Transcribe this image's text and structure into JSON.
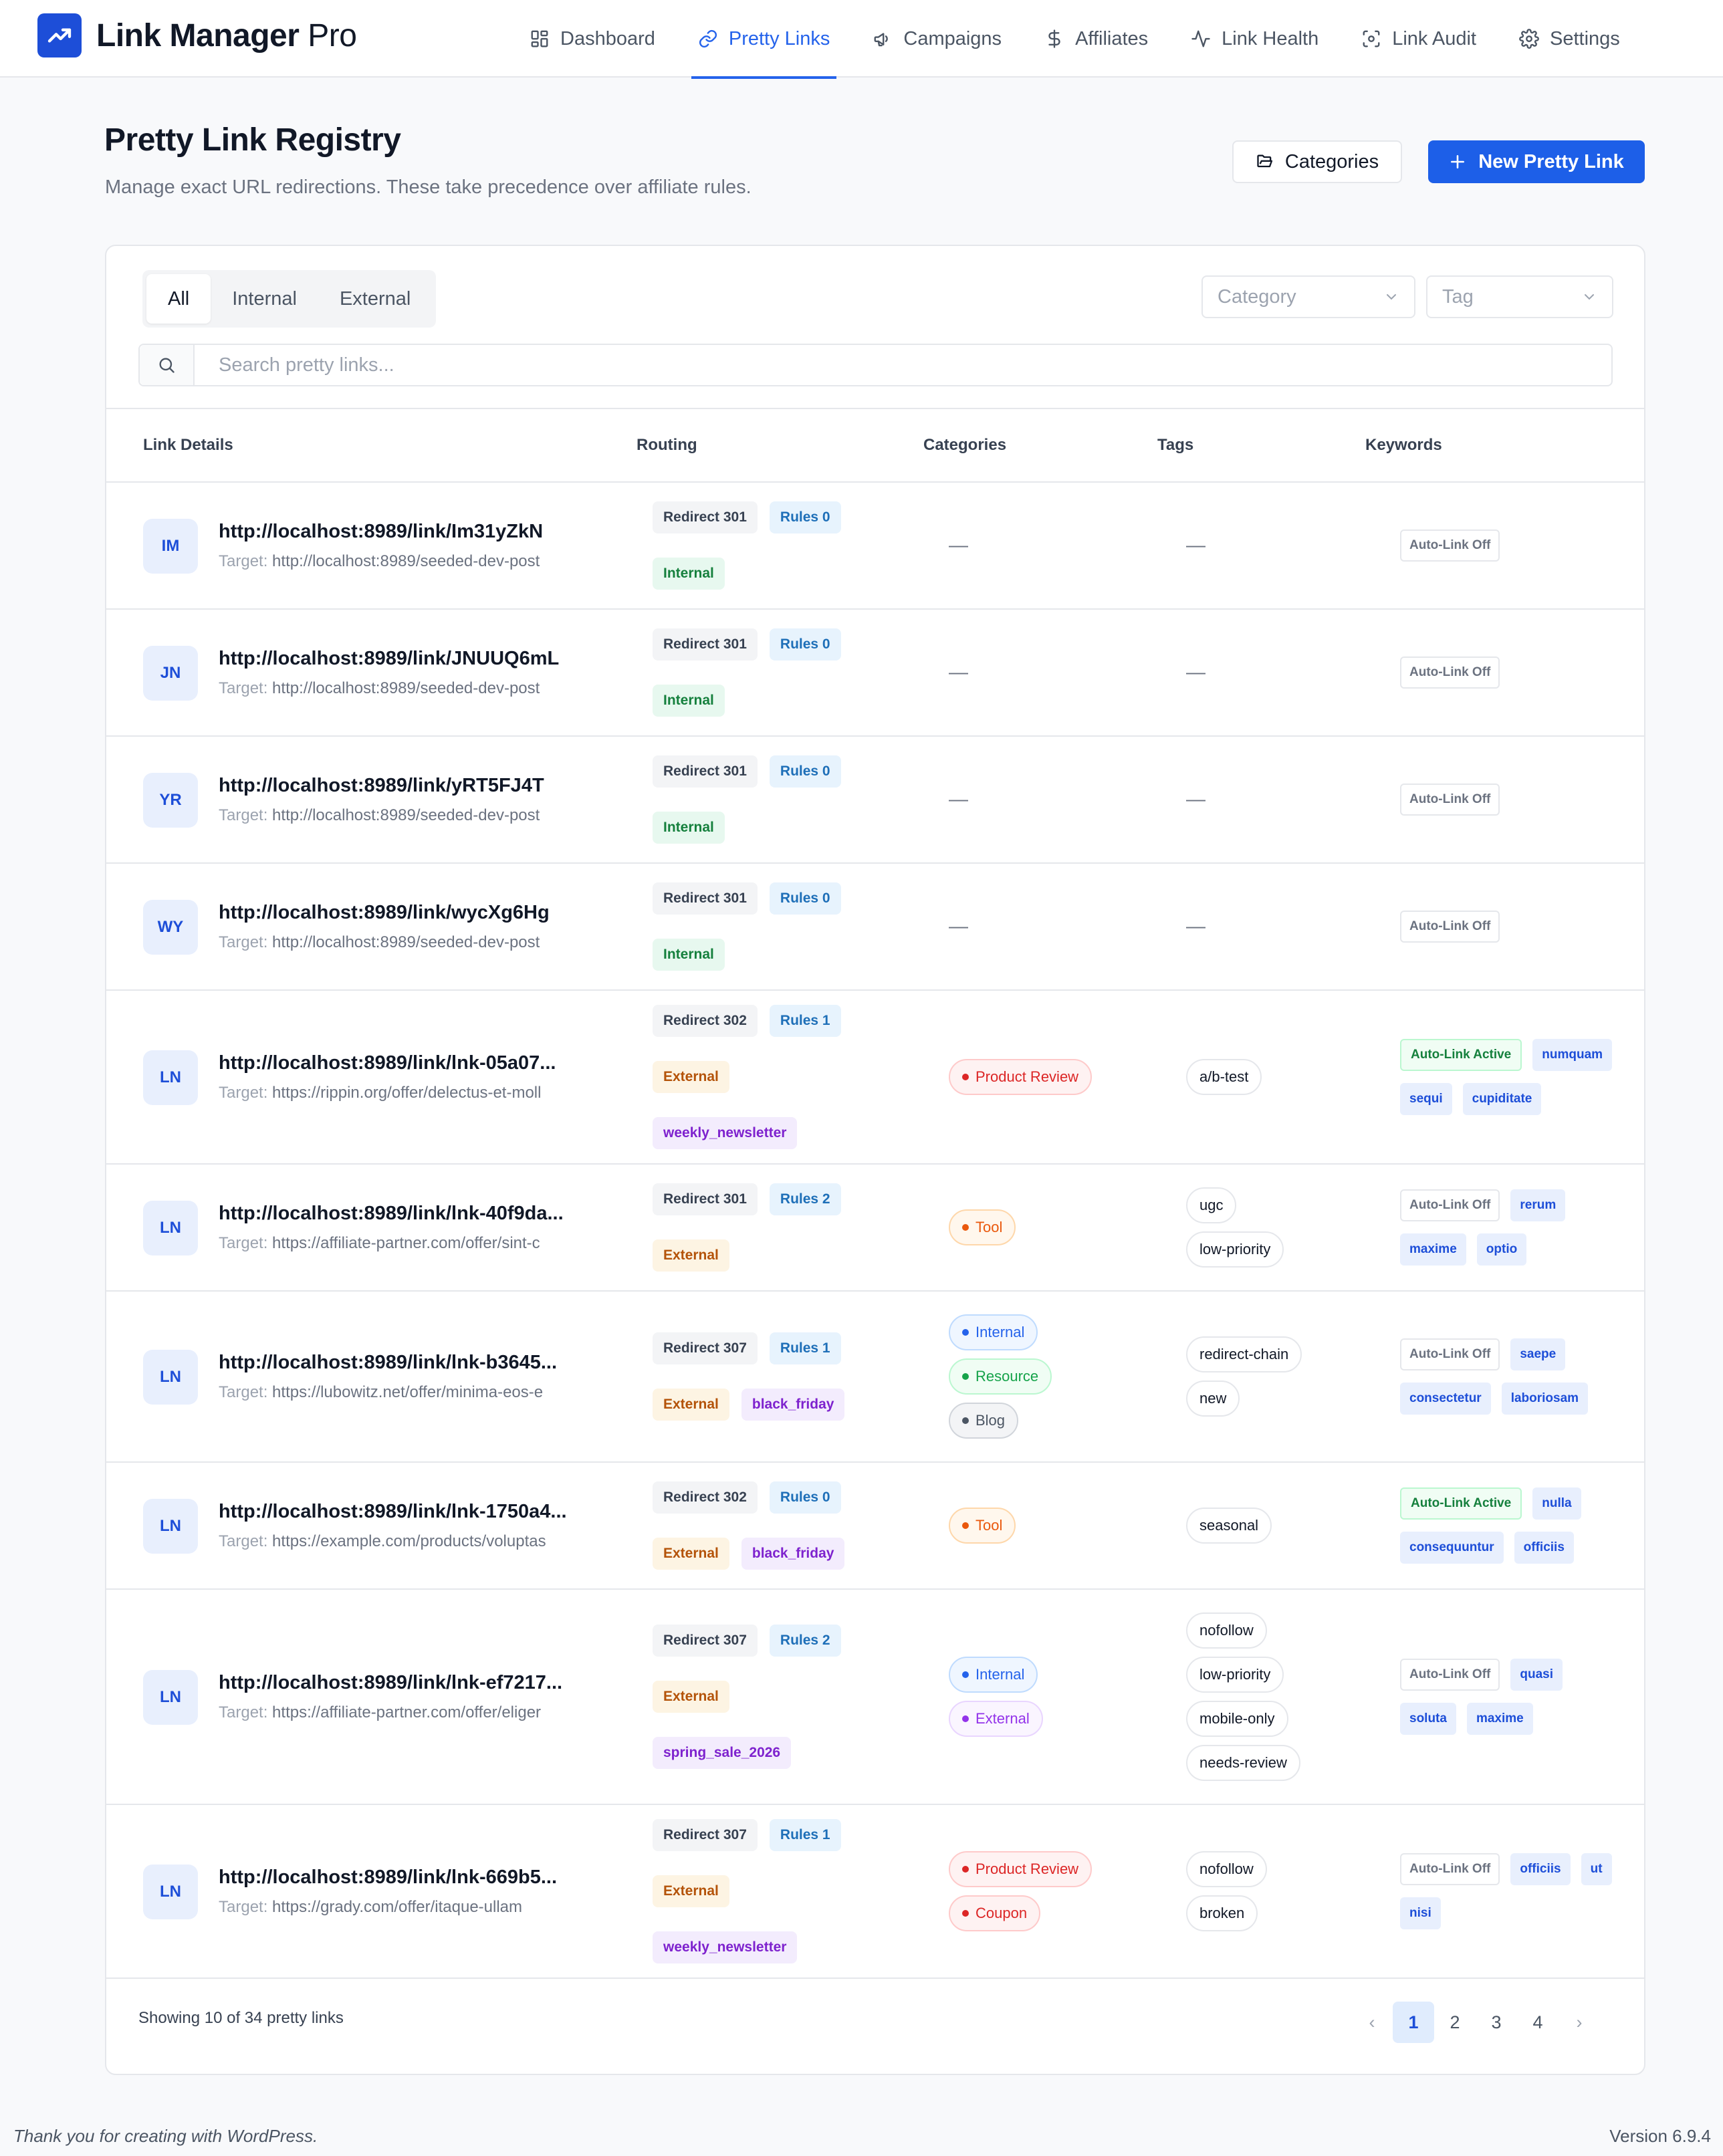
{
  "brand": {
    "name_bold": "Link Manager",
    "name_light": "Pro"
  },
  "nav": [
    {
      "label": "Dashboard",
      "icon": "grid-icon"
    },
    {
      "label": "Pretty Links",
      "icon": "link-icon",
      "active": true
    },
    {
      "label": "Campaigns",
      "icon": "megaphone-icon"
    },
    {
      "label": "Affiliates",
      "icon": "dollar-icon"
    },
    {
      "label": "Link Health",
      "icon": "activity-icon"
    },
    {
      "label": "Link Audit",
      "icon": "scan-icon"
    },
    {
      "label": "Settings",
      "icon": "gear-icon"
    }
  ],
  "header": {
    "title": "Pretty Link Registry",
    "subtitle": "Manage exact URL redirections. These take precedence over affiliate rules.",
    "categories_button": "Categories",
    "new_button": "New Pretty Link"
  },
  "filters": {
    "tabs": [
      "All",
      "Internal",
      "External"
    ],
    "category_placeholder": "Category",
    "tag_placeholder": "Tag",
    "search_placeholder": "Search pretty links..."
  },
  "table": {
    "columns": [
      "Link Details",
      "Routing",
      "Categories",
      "Tags",
      "Keywords"
    ],
    "target_label": "Target:",
    "rows": [
      {
        "initials": "IM",
        "url": "http://localhost:8989/link/Im31yZkN",
        "target": "http://localhost:8989/seeded-dev-post",
        "redirect": "Redirect 301",
        "rules": "Rules 0",
        "type": "Internal",
        "campaign": "",
        "categories": [],
        "tags": [],
        "keywords": [
          {
            "text": "Auto-Link Off",
            "kind": "off"
          }
        ],
        "empty_mark": "—"
      },
      {
        "initials": "JN",
        "url": "http://localhost:8989/link/JNUUQ6mL",
        "target": "http://localhost:8989/seeded-dev-post",
        "redirect": "Redirect 301",
        "rules": "Rules 0",
        "type": "Internal",
        "campaign": "",
        "categories": [],
        "tags": [],
        "keywords": [
          {
            "text": "Auto-Link Off",
            "kind": "off"
          }
        ],
        "empty_mark": "—"
      },
      {
        "initials": "YR",
        "url": "http://localhost:8989/link/yRT5FJ4T",
        "target": "http://localhost:8989/seeded-dev-post",
        "redirect": "Redirect 301",
        "rules": "Rules 0",
        "type": "Internal",
        "campaign": "",
        "categories": [],
        "tags": [],
        "keywords": [
          {
            "text": "Auto-Link Off",
            "kind": "off"
          }
        ],
        "empty_mark": "—"
      },
      {
        "initials": "WY",
        "url": "http://localhost:8989/link/wycXg6Hg",
        "target": "http://localhost:8989/seeded-dev-post",
        "redirect": "Redirect 301",
        "rules": "Rules 0",
        "type": "Internal",
        "campaign": "",
        "categories": [],
        "tags": [],
        "keywords": [
          {
            "text": "Auto-Link Off",
            "kind": "off"
          }
        ],
        "empty_mark": "—"
      },
      {
        "initials": "LN",
        "url": "http://localhost:8989/link/lnk-05a07...",
        "target": "https://rippin.org/offer/delectus-et-moll",
        "redirect": "Redirect 302",
        "rules": "Rules 1",
        "type": "External",
        "campaign": "weekly_newsletter",
        "categories": [
          {
            "text": "Product Review",
            "color": "red"
          }
        ],
        "tags": [
          "a/b-test"
        ],
        "keywords": [
          {
            "text": "Auto-Link Active",
            "kind": "on"
          },
          {
            "text": "numquam",
            "kind": "kw"
          },
          {
            "text": "sequi",
            "kind": "kw"
          },
          {
            "text": "cupiditate",
            "kind": "kw"
          }
        ]
      },
      {
        "initials": "LN",
        "url": "http://localhost:8989/link/lnk-40f9da...",
        "target": "https://affiliate-partner.com/offer/sint-c",
        "redirect": "Redirect 301",
        "rules": "Rules 2",
        "type": "External",
        "campaign": "",
        "categories": [
          {
            "text": "Tool",
            "color": "orange"
          }
        ],
        "tags": [
          "ugc",
          "low-priority"
        ],
        "keywords": [
          {
            "text": "Auto-Link Off",
            "kind": "off"
          },
          {
            "text": "rerum",
            "kind": "kw"
          },
          {
            "text": "maxime",
            "kind": "kw"
          },
          {
            "text": "optio",
            "kind": "kw"
          }
        ]
      },
      {
        "initials": "LN",
        "url": "http://localhost:8989/link/lnk-b3645...",
        "target": "https://lubowitz.net/offer/minima-eos-e",
        "redirect": "Redirect 307",
        "rules": "Rules 1",
        "type": "External",
        "campaign": "black_friday",
        "categories": [
          {
            "text": "Internal",
            "color": "blue"
          },
          {
            "text": "Resource",
            "color": "green"
          },
          {
            "text": "Blog",
            "color": "gray"
          }
        ],
        "tags": [
          "redirect-chain",
          "new"
        ],
        "keywords": [
          {
            "text": "Auto-Link Off",
            "kind": "off"
          },
          {
            "text": "saepe",
            "kind": "kw"
          },
          {
            "text": "consectetur",
            "kind": "kw"
          },
          {
            "text": "laboriosam",
            "kind": "kw"
          }
        ]
      },
      {
        "initials": "LN",
        "url": "http://localhost:8989/link/lnk-1750a4...",
        "target": "https://example.com/products/voluptas",
        "redirect": "Redirect 302",
        "rules": "Rules 0",
        "type": "External",
        "campaign": "black_friday",
        "categories": [
          {
            "text": "Tool",
            "color": "orange"
          }
        ],
        "tags": [
          "seasonal"
        ],
        "keywords": [
          {
            "text": "Auto-Link Active",
            "kind": "on"
          },
          {
            "text": "nulla",
            "kind": "kw"
          },
          {
            "text": "consequuntur",
            "kind": "kw"
          },
          {
            "text": "officiis",
            "kind": "kw"
          }
        ]
      },
      {
        "initials": "LN",
        "url": "http://localhost:8989/link/lnk-ef7217...",
        "target": "https://affiliate-partner.com/offer/eliger",
        "redirect": "Redirect 307",
        "rules": "Rules 2",
        "type": "External",
        "campaign": "spring_sale_2026",
        "categories": [
          {
            "text": "Internal",
            "color": "blue"
          },
          {
            "text": "External",
            "color": "purple"
          }
        ],
        "tags": [
          "nofollow",
          "low-priority",
          "mobile-only",
          "needs-review"
        ],
        "keywords": [
          {
            "text": "Auto-Link Off",
            "kind": "off"
          },
          {
            "text": "quasi",
            "kind": "kw"
          },
          {
            "text": "soluta",
            "kind": "kw"
          },
          {
            "text": "maxime",
            "kind": "kw"
          }
        ]
      },
      {
        "initials": "LN",
        "url": "http://localhost:8989/link/lnk-669b5...",
        "target": "https://grady.com/offer/itaque-ullam",
        "redirect": "Redirect 307",
        "rules": "Rules 1",
        "type": "External",
        "campaign": "weekly_newsletter",
        "categories": [
          {
            "text": "Product Review",
            "color": "red"
          },
          {
            "text": "Coupon",
            "color": "red"
          }
        ],
        "tags": [
          "nofollow",
          "broken"
        ],
        "keywords": [
          {
            "text": "Auto-Link Off",
            "kind": "off"
          },
          {
            "text": "officiis",
            "kind": "kw"
          },
          {
            "text": "ut",
            "kind": "kw"
          },
          {
            "text": "nisi",
            "kind": "kw"
          }
        ]
      }
    ]
  },
  "pagination": {
    "summary": "Showing 10 of 34 pretty links",
    "prev": "‹",
    "next": "›",
    "pages": [
      "1",
      "2",
      "3",
      "4"
    ],
    "current": "1"
  },
  "footer": {
    "thanks": "Thank you for creating with WordPress.",
    "version": "Version 6.9.4"
  },
  "colors": {
    "accent": "#2563eb",
    "primary_button": "#1d5fe8"
  }
}
